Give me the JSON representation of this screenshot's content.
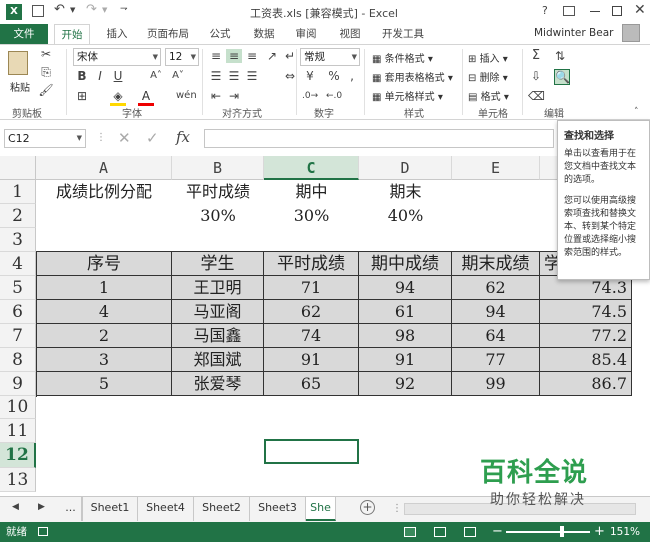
{
  "window": {
    "title": "工资表.xls [兼容模式] - Excel",
    "help": "?",
    "user": "Midwinter Bear"
  },
  "ribbon_tabs": [
    "文件",
    "开始",
    "插入",
    "页面布局",
    "公式",
    "数据",
    "审阅",
    "视图",
    "开发工具"
  ],
  "ribbon": {
    "paste": "粘贴",
    "clipboard": "剪贴板",
    "font_name": "宋体",
    "font_size": "12",
    "font_group": "字体",
    "align_group": "对齐方式",
    "number_format": "常规",
    "number_group": "数字",
    "cond_format": "条件格式",
    "table_format": "套用表格格式",
    "cell_style": "单元格样式",
    "style_group": "样式",
    "insert": "插入",
    "delete": "删除",
    "format": "格式",
    "cells_group": "单元格",
    "edit_group": "编辑",
    "bold": "B",
    "italic": "I",
    "underline": "U",
    "fx": "fx"
  },
  "formula_bar": {
    "name_box": "C12",
    "formula": ""
  },
  "columns": [
    "A",
    "B",
    "C",
    "D",
    "E"
  ],
  "rows": [
    "1",
    "2",
    "3",
    "4",
    "5",
    "6",
    "7",
    "8",
    "9",
    "10",
    "11",
    "12",
    "13"
  ],
  "cells": {
    "a1": "成绩比例分配",
    "b1": "平时成绩",
    "c1": "期中",
    "d1": "期末",
    "b2": "30%",
    "c2": "30%",
    "d2": "40%"
  },
  "table": {
    "headers": [
      "序号",
      "学生",
      "平时成绩",
      "期中成绩",
      "期末成绩",
      "学"
    ],
    "rows": [
      [
        "1",
        "王卫明",
        "71",
        "94",
        "62",
        "74.3"
      ],
      [
        "4",
        "马亚阁",
        "62",
        "61",
        "94",
        "74.5"
      ],
      [
        "2",
        "马国鑫",
        "74",
        "98",
        "64",
        "77.2"
      ],
      [
        "3",
        "郑国斌",
        "91",
        "91",
        "77",
        "85.4"
      ],
      [
        "5",
        "张爱琴",
        "65",
        "92",
        "99",
        "86.7"
      ]
    ]
  },
  "sheet_tabs": [
    "...",
    "Sheet1",
    "Sheet4",
    "Sheet2",
    "Sheet3",
    "She"
  ],
  "status": {
    "ready": "就绪",
    "zoom": "151%"
  },
  "tooltip": {
    "title": "查找和选择",
    "p1": "单击以查看用于在您文档中查找文本的选项。",
    "p2": "您可以使用高级搜索项查找和替换文本、转到某个特定位置或选择缩小搜索范围的样式。"
  },
  "watermark": {
    "name": "百科全说",
    "slogan": "助你轻松解决"
  },
  "colors": {
    "accent": "#217346",
    "table_fill": "#d9d9d9",
    "watermark": "#2e9e4f"
  }
}
